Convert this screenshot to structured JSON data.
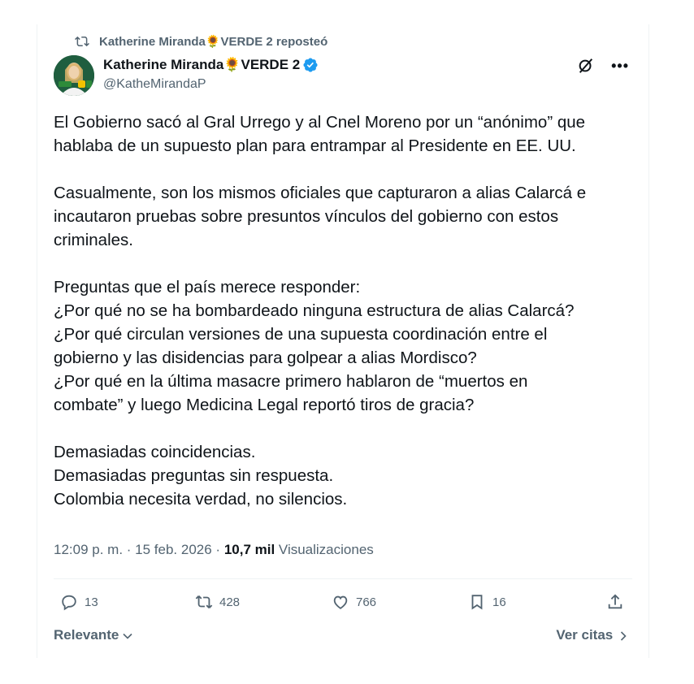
{
  "repost": {
    "text": "Katherine Miranda🌻VERDE 2 reposteó"
  },
  "author": {
    "name": "Katherine Miranda🌻VERDE 2",
    "handle": "@KatheMirandaP",
    "verified_color": "#1d9bf0"
  },
  "tweet": {
    "lines": [
      "El Gobierno sacó al Gral Urrego y al Cnel Moreno por un “anónimo” que",
      "hablaba de un supuesto plan para entrampar al Presidente en EE. UU.",
      "",
      "Casualmente, son los mismos oficiales que capturaron a alias Calarcá e",
      "incautaron pruebas sobre presuntos vínculos del gobierno con estos",
      "criminales.",
      "",
      "Preguntas que el país merece responder:",
      "¿Por qué no se ha bombardeado ninguna estructura de alias Calarcá?",
      "¿Por qué circulan versiones de una supuesta coordinación entre el",
      "gobierno y las disidencias para golpear a alias Mordisco?",
      "¿Por qué en la última masacre primero hablaron de “muertos en",
      "combate” y luego Medicina Legal reportó tiros de gracia?",
      "",
      "Demasiadas coincidencias.",
      "Demasiadas preguntas sin respuesta.",
      "Colombia necesita verdad, no silencios."
    ]
  },
  "meta": {
    "time": "12:09 p. m.",
    "sep1": " · ",
    "date": "15 feb. 2026",
    "sep2": " · ",
    "views": "10,7 mil",
    "views_label": " Visualizaciones"
  },
  "actions": {
    "replies": "13",
    "reposts": "428",
    "likes": "766",
    "bookmarks": "16"
  },
  "footer": {
    "sort_label": "Relevante",
    "quotes_label": "Ver citas"
  },
  "icons": [
    "repost-icon",
    "verified-icon",
    "grok-icon",
    "more-icon",
    "reply-icon",
    "retweet-icon",
    "like-icon",
    "bookmark-icon",
    "share-icon",
    "chevron-down-icon",
    "chevron-right-icon"
  ]
}
